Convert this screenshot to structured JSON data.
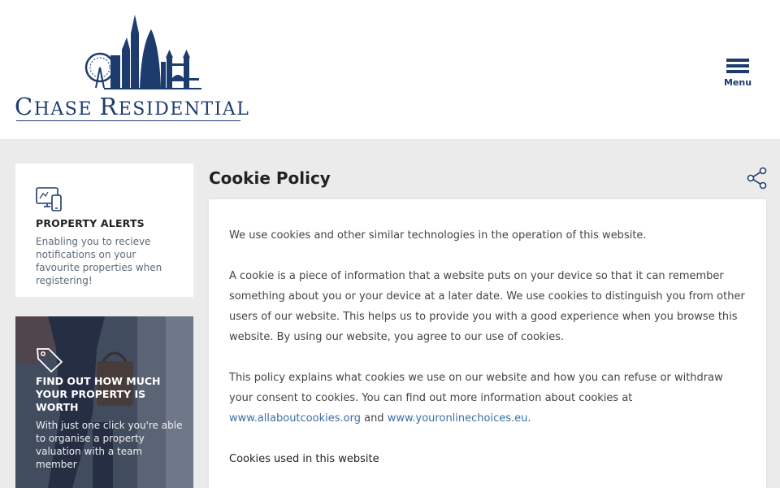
{
  "header": {
    "logo_text_big1": "C",
    "logo_text_small1": "HASE ",
    "logo_text_big2": "R",
    "logo_text_small2": "ESIDENTIAL",
    "menu_label": "Menu",
    "brand_color": "#1d3c6e"
  },
  "sidebar": {
    "alerts": {
      "icon": "devices-icon",
      "title": "PROPERTY ALERTS",
      "description": "Enabling you to recieve notifications on your favourite properties when registering!"
    },
    "valuation": {
      "icon": "tag-icon",
      "title": "FIND OUT HOW MUCH YOUR PROPERTY IS WORTH",
      "description": "With just one click you're able to organise a property valuation with a team member"
    }
  },
  "main": {
    "title": "Cookie Policy",
    "share_icon": "share-icon",
    "paragraphs": {
      "p1": "We use cookies and other similar technologies in the operation of this website.",
      "p2": "A cookie is a piece of information that a website puts on your device so that it can remember something about you or your device at a later date. We use cookies to distinguish you from other users of our website. This helps us to provide you with a good experience when you browse this website. By using our website, you agree to our use of cookies.",
      "p3_start": "This policy explains what cookies we use on our website and how you can refuse or withdraw your consent to cookies. You can find out more information about cookies at ",
      "link1": "www.allaboutcookies.org",
      "p3_mid": " and ",
      "link2": "www.youronlinechoices.eu",
      "p3_end": ".",
      "p4": "Cookies used in this website"
    },
    "link_color": "#3a6ea5"
  }
}
